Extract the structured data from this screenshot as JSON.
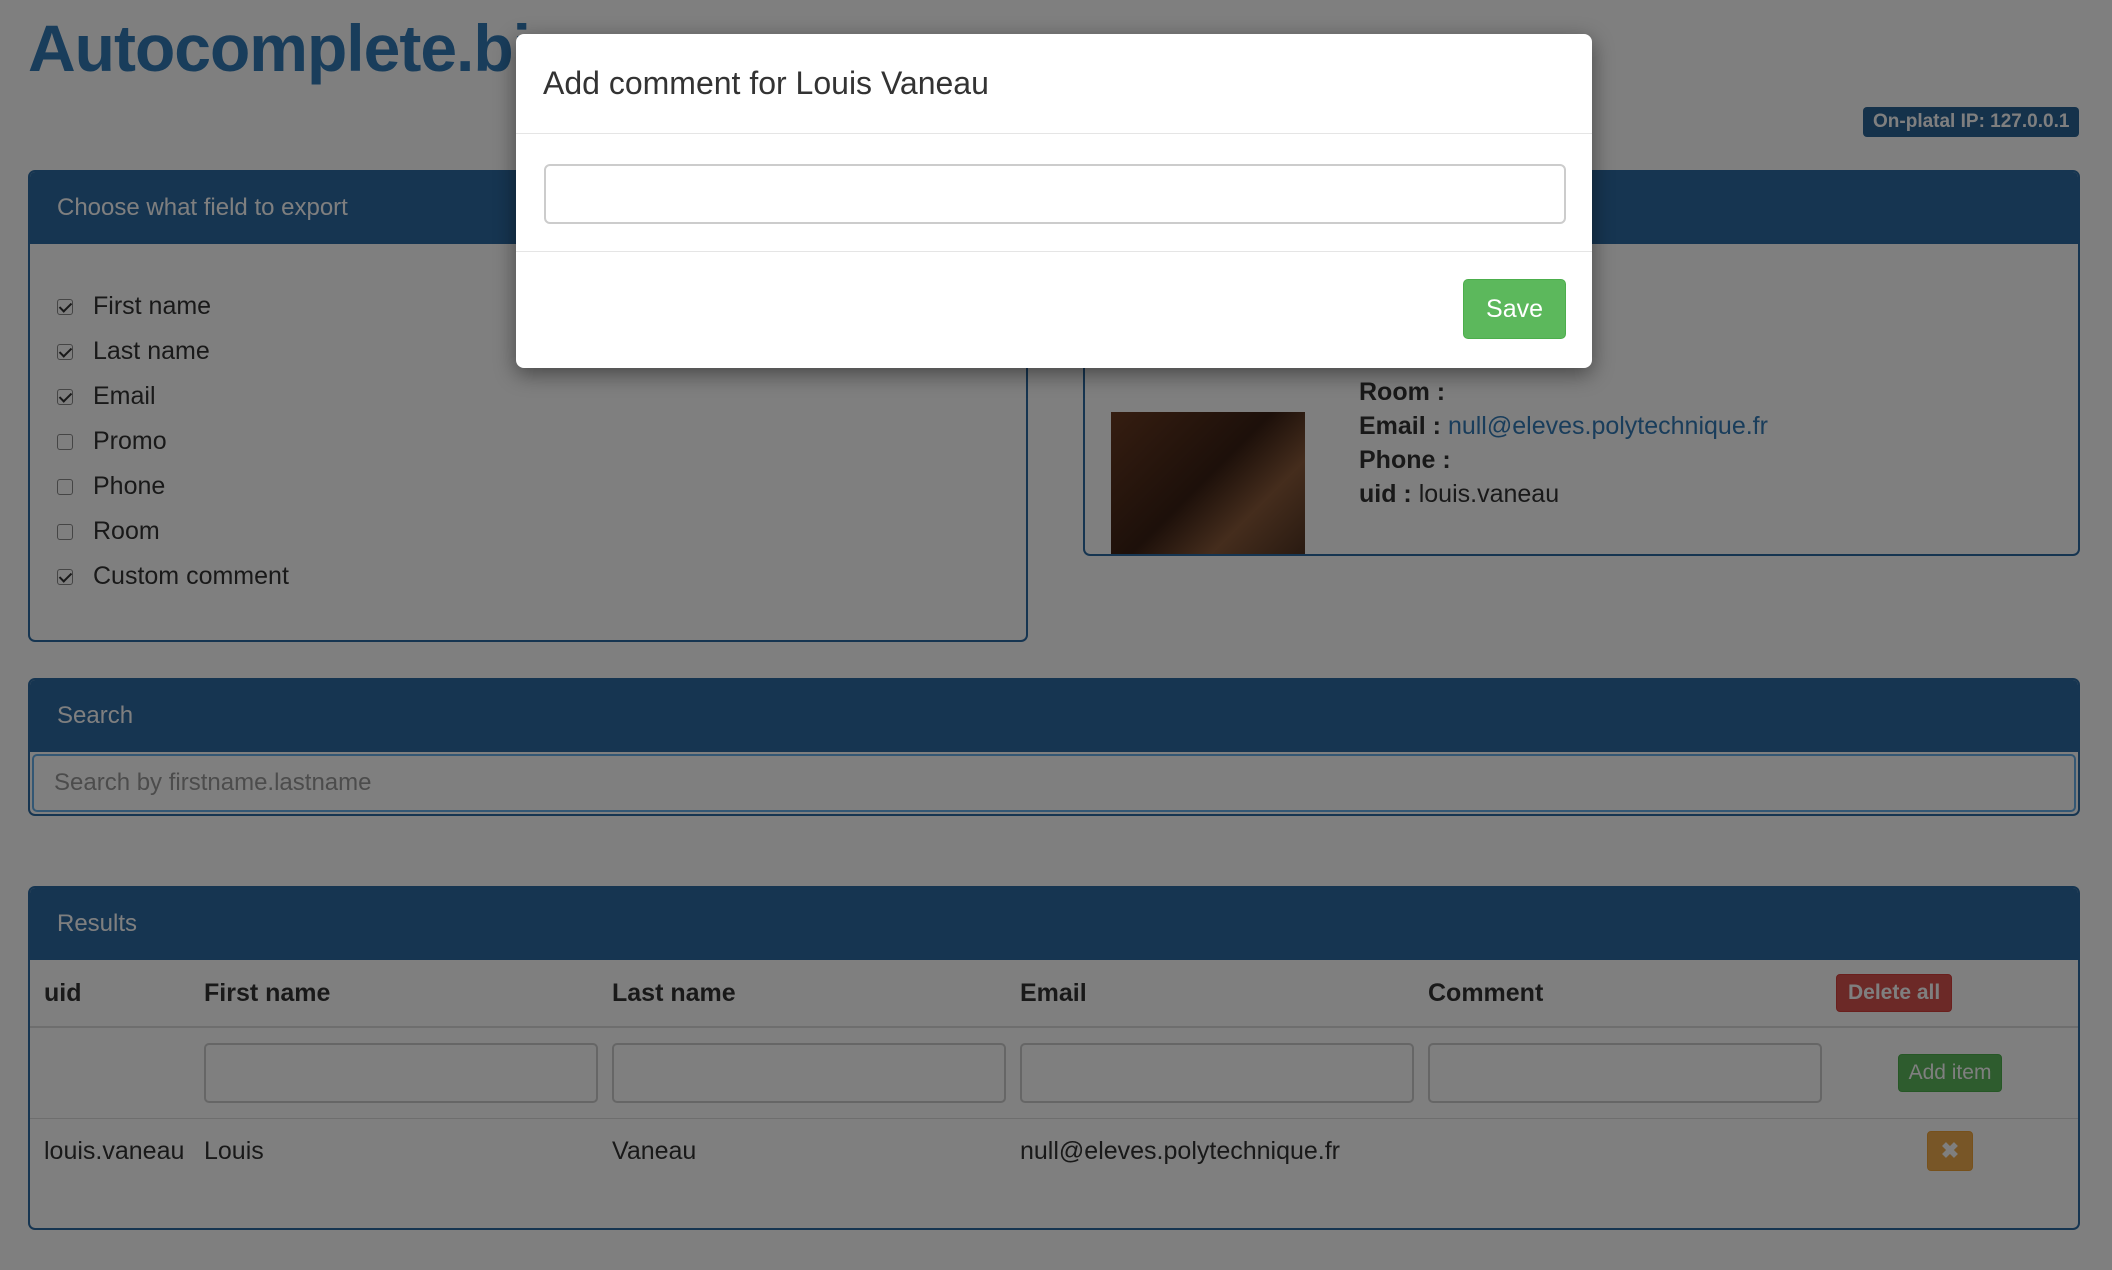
{
  "app": {
    "title": "Autocomplete.bi",
    "ip_badge": "On-platal IP: 127.0.0.1"
  },
  "export_panel": {
    "heading": "Choose what field to export",
    "fields": [
      {
        "label": "First name",
        "checked": true
      },
      {
        "label": "Last name",
        "checked": true
      },
      {
        "label": "Email",
        "checked": true
      },
      {
        "label": "Promo",
        "checked": false
      },
      {
        "label": "Phone",
        "checked": false
      },
      {
        "label": "Room",
        "checked": false
      },
      {
        "label": "Custom comment",
        "checked": true
      }
    ]
  },
  "profile": {
    "room_label": "Room :",
    "room_value": "",
    "email_label": "Email :",
    "email_value": "null@eleves.polytechnique.fr",
    "phone_label": "Phone :",
    "phone_value": "",
    "uid_label": "uid :",
    "uid_value": "louis.vaneau"
  },
  "search": {
    "heading": "Search",
    "placeholder": "Search by firstname.lastname"
  },
  "results": {
    "heading": "Results",
    "columns": [
      "uid",
      "First name",
      "Last name",
      "Email",
      "Comment"
    ],
    "delete_all_label": "Delete all",
    "add_item_label": "Add item",
    "rows": [
      {
        "uid": "louis.vaneau",
        "first_name": "Louis",
        "last_name": "Vaneau",
        "email": "null@eleves.polytechnique.fr",
        "comment": ""
      }
    ],
    "remove_icon": "✖"
  },
  "modal": {
    "title": "Add comment for Louis Vaneau",
    "input_value": "",
    "save_label": "Save"
  },
  "colors": {
    "brand": "#337ab7",
    "panel_heading": "#2c6aa3",
    "success": "#5cb85c",
    "danger": "#d9534f",
    "warning": "#f0ad4e"
  }
}
